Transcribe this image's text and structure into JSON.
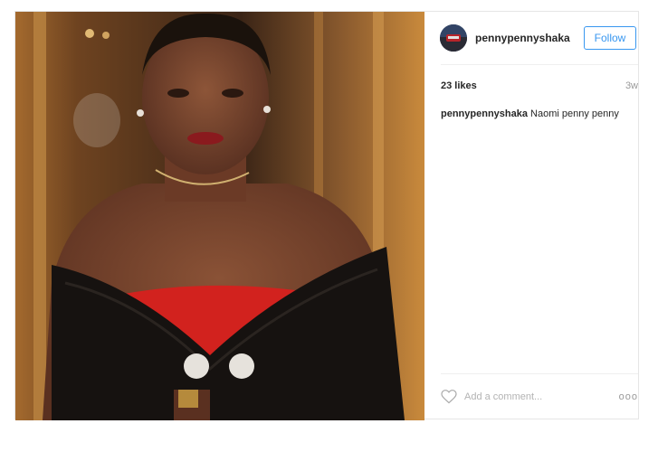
{
  "post": {
    "photo": {
      "icon": "portrait-photo"
    },
    "header": {
      "avatar_icon": "avatar",
      "username": "pennypennyshaka",
      "follow_label": "Follow"
    },
    "meta": {
      "likes": "23 likes",
      "time_ago": "3w"
    },
    "caption": {
      "username": "pennypennyshaka",
      "text": "Naomi penny penny"
    },
    "comment_bar": {
      "like_icon": "heart-outline-icon",
      "placeholder": "Add a comment...",
      "more_icon": "more-options-icon",
      "more_glyph": "ooo"
    }
  },
  "colors": {
    "link_blue": "#3897f0",
    "text": "#262626",
    "muted": "#999999"
  }
}
